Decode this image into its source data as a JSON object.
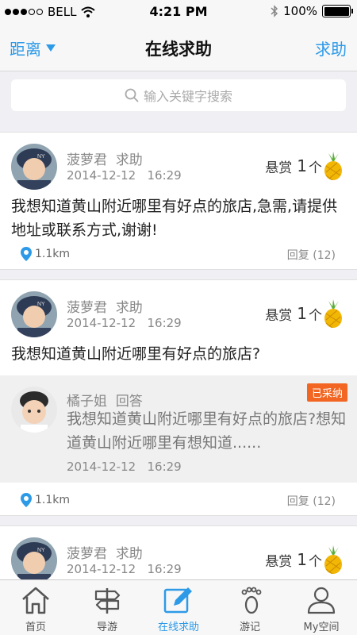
{
  "status": {
    "carrier": "BELL",
    "time": "4:21 PM",
    "battery": "100%",
    "battery_level": 1.0
  },
  "nav": {
    "left_label": "距离",
    "title": "在线求助",
    "right_label": "求助"
  },
  "search": {
    "placeholder": "输入关键字搜索"
  },
  "colors": {
    "accent": "#2d9ae8",
    "adopted_badge": "#f26522"
  },
  "posts": [
    {
      "name": "菠萝君",
      "role": "求助",
      "date": "2014-12-12",
      "time": "16:29",
      "reward_label": "悬赏",
      "reward_num": "1",
      "reward_unit": "个",
      "question": "我想知道黄山附近哪里有好点的旅店,急需,请提供地址或联系方式,谢谢!",
      "distance": "1.1km",
      "reply": "回复 (12)"
    },
    {
      "name": "菠萝君",
      "role": "求助",
      "date": "2014-12-12",
      "time": "16:29",
      "reward_label": "悬赏",
      "reward_num": "1",
      "reward_unit": "个",
      "question": "我想知道黄山附近哪里有好点的旅店?",
      "answer": {
        "name": "橘子姐",
        "role": "回答",
        "badge": "已采纳",
        "text": "我想知道黄山附近哪里有好点的旅店?想知道黄山附近哪里有想知道......",
        "date": "2014-12-12",
        "time": "16:29"
      },
      "distance": "1.1km",
      "reply": "回复 (12)"
    },
    {
      "name": "菠萝君",
      "role": "求助",
      "date": "2014-12-12",
      "time": "16:29",
      "reward_label": "悬赏",
      "reward_num": "1",
      "reward_unit": "个"
    }
  ],
  "tabs": [
    {
      "label": "首页",
      "icon": "home-icon"
    },
    {
      "label": "导游",
      "icon": "signpost-icon"
    },
    {
      "label": "在线求助",
      "icon": "edit-icon",
      "active": true
    },
    {
      "label": "游记",
      "icon": "footprint-icon"
    },
    {
      "label": "My空间",
      "icon": "user-icon"
    }
  ]
}
